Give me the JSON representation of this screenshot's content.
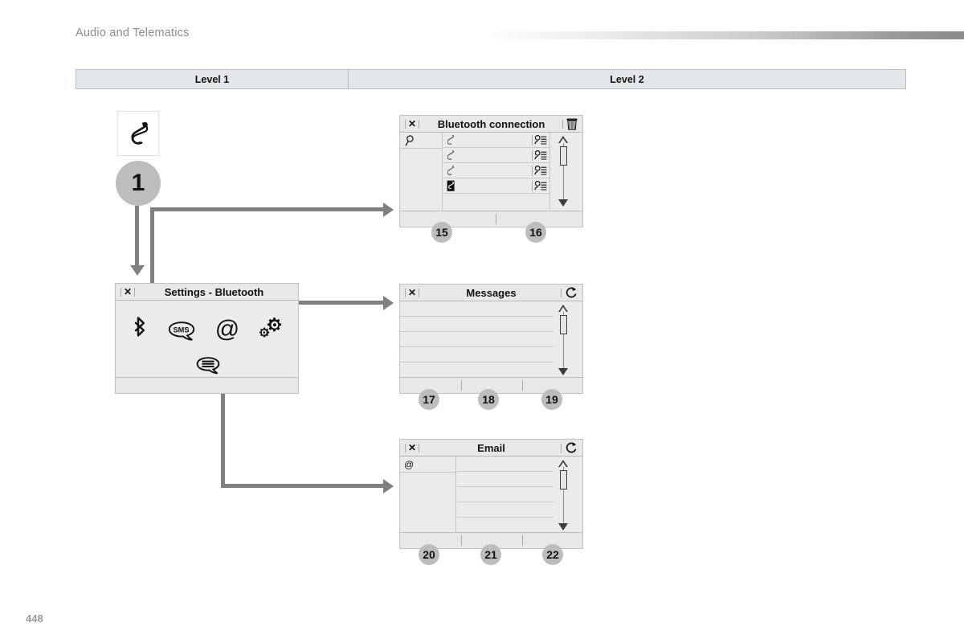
{
  "header": {
    "section_title": "Audio and Telematics",
    "gradient_bar": "decorative-gradient"
  },
  "level_table": {
    "columns": [
      {
        "label": "Level 1"
      },
      {
        "label": "Level 2"
      }
    ]
  },
  "level1": {
    "icon": "phone-handset-icon",
    "step_number": "1"
  },
  "panels": [
    {
      "id": "bluetooth-connection",
      "title": "Bluetooth connection",
      "close_label": "✕",
      "right_icon": "trash-bin-icon",
      "sidebar_icon": "magnifier-icon",
      "rows": [
        {
          "left_icon": "phone-handset-icon",
          "right_icon": "contact-list-icon"
        },
        {
          "left_icon": "phone-handset-icon",
          "right_icon": "contact-list-icon"
        },
        {
          "left_icon": "phone-handset-icon",
          "right_icon": "contact-list-icon"
        },
        {
          "left_icon": "phone-filled-icon",
          "right_icon": "contact-list-icon"
        }
      ],
      "callouts": [
        {
          "number": "15"
        },
        {
          "number": "16"
        }
      ]
    },
    {
      "id": "settings-bluetooth",
      "title": "Settings - Bluetooth",
      "close_label": "✕",
      "icons": [
        {
          "name": "bluetooth-icon",
          "label": ""
        },
        {
          "name": "sms-bubble-icon",
          "label": "SMS"
        },
        {
          "name": "at-sign-icon",
          "label": "@"
        },
        {
          "name": "gears-icon",
          "label": ""
        },
        {
          "name": "message-lines-bubble-icon",
          "label": ""
        }
      ]
    },
    {
      "id": "messages",
      "title": "Messages",
      "close_label": "✕",
      "right_icon": "refresh-icon",
      "row_count": 5,
      "callouts": [
        {
          "number": "17"
        },
        {
          "number": "18"
        },
        {
          "number": "19"
        }
      ]
    },
    {
      "id": "email",
      "title": "Email",
      "close_label": "✕",
      "right_icon": "refresh-icon",
      "sidebar_icon": "at-sign-icon",
      "sidebar_label": "@",
      "row_count": 5,
      "callouts": [
        {
          "number": "20"
        },
        {
          "number": "21"
        },
        {
          "number": "22"
        }
      ]
    }
  ],
  "footer": {
    "page_number": "448"
  },
  "colors": {
    "connector": "#808080",
    "circle_fill": "#bdbdbd",
    "panel_bg": "#ebebeb",
    "table_header_bg": "#e4e7ea",
    "section_title": "#8d8d8d"
  }
}
